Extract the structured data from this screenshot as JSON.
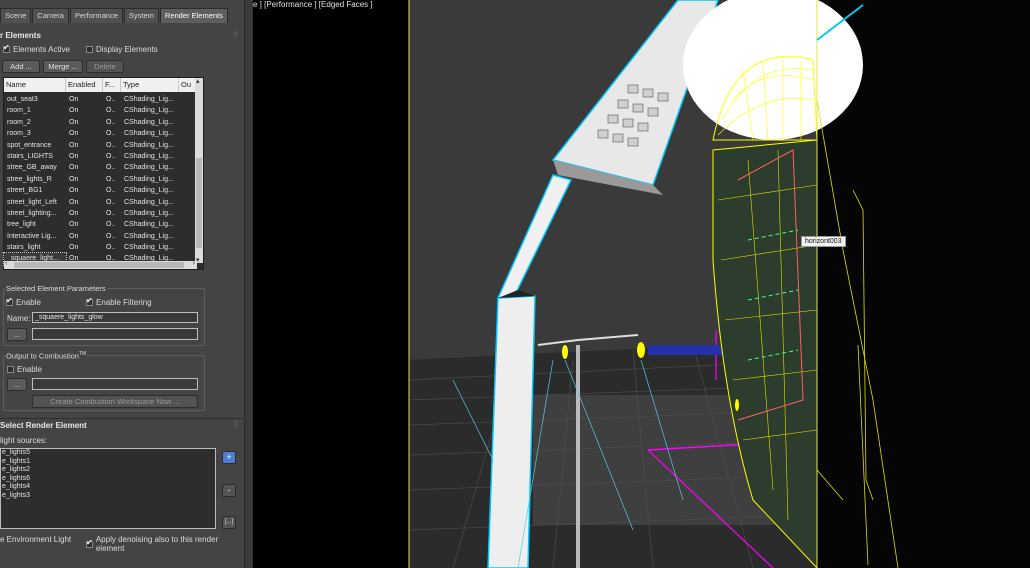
{
  "tabs": [
    {
      "label": "Scene"
    },
    {
      "label": "Camera"
    },
    {
      "label": "Performance"
    },
    {
      "label": "System"
    },
    {
      "label": "Render Elements"
    }
  ],
  "render_elements": {
    "title": "r Elements",
    "elements_active": "Elements Active",
    "display_elements": "Display Elements",
    "add_btn": "Add ...",
    "merge_btn": "Merge ...",
    "delete_btn": "Delete"
  },
  "list": {
    "columns": [
      "Name",
      "Enabled",
      "F...",
      "Type",
      "Ou"
    ],
    "rows": [
      [
        "out_seat3",
        "On",
        "O..",
        "CShading_Lig..."
      ],
      [
        "room_1",
        "On",
        "O..",
        "CShading_Lig..."
      ],
      [
        "room_2",
        "On",
        "O..",
        "CShading_Lig..."
      ],
      [
        "room_3",
        "On",
        "O..",
        "CShading_Lig..."
      ],
      [
        "spot_entrance",
        "On",
        "O..",
        "CShading_Lig..."
      ],
      [
        "stairs_LIGHTS",
        "On",
        "O..",
        "CShading_Lig..."
      ],
      [
        "stree_GB_away",
        "On",
        "O..",
        "CShading_Lig..."
      ],
      [
        "stree_lights_R",
        "On",
        "O..",
        "CShading_Lig..."
      ],
      [
        "street_BG1",
        "On",
        "O..",
        "CShading_Lig..."
      ],
      [
        "street_light_Left",
        "On",
        "O..",
        "CShading_Lig..."
      ],
      [
        "street_lighting...",
        "On",
        "O..",
        "CShading_Lig..."
      ],
      [
        "tree_light",
        "On",
        "O..",
        "CShading_Lig..."
      ],
      [
        "Interactive Lig...",
        "On",
        "O..",
        "CShading_Lig..."
      ],
      [
        "stairs_light",
        "On",
        "O..",
        "CShading_Lig..."
      ],
      [
        "_squaere_light...",
        "On",
        "O..",
        "CShading_Lig..."
      ]
    ]
  },
  "selected_params": {
    "title": "Selected Element Parameters",
    "enable": "Enable",
    "enable_filtering": "Enable Filtering",
    "name_label": "Name:",
    "name_value": "_squaere_lights_glow",
    "browse_btn": "..."
  },
  "combustion": {
    "title": "Output to Combustion",
    "tm": "TM",
    "enable": "Enable",
    "browse_btn": "...",
    "create_btn": "Create Combustion Workspace Now ..."
  },
  "select_render": {
    "title": "Select Render Element",
    "light_sources_label": "light sources:",
    "lights": [
      "e_lights5",
      "e_lights1",
      "e_lights2",
      "e_lights6",
      "e_lights4",
      "e_lights3"
    ],
    "plus_btn": "+",
    "minus_btn": "-",
    "more_btn": "[...]",
    "env_light": "e Environment Light",
    "apply_denoise": "Apply denoising also to this render element"
  },
  "viewport": {
    "label": "e ] [Performance ] [Edged Faces ]",
    "tooltip": "horizont003"
  },
  "colors": {
    "panel_bg": "#444444",
    "accent_blue": "#4a7fd4",
    "wire_yellow": "#ffff00",
    "wire_cyan": "#00c8ff",
    "wire_magenta": "#ff00ff"
  }
}
